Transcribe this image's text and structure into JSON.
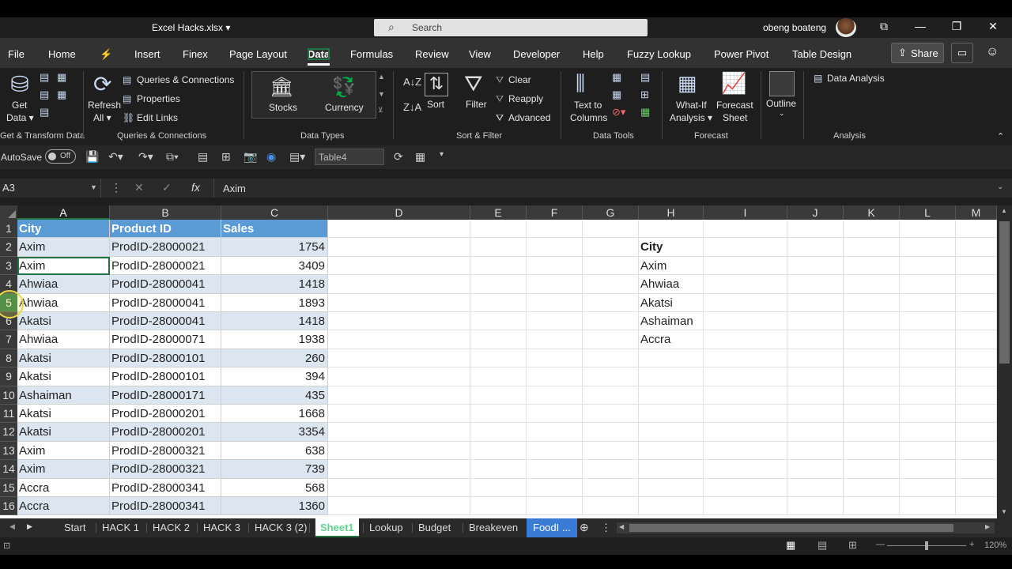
{
  "title": {
    "file_name": "Excel Hacks.xlsx ▾",
    "search_placeholder": "Search",
    "user_name": "obeng boateng",
    "btn_ribbon": "⧉",
    "btn_min": "—",
    "btn_restore": "❐",
    "btn_close": "✕"
  },
  "menu": {
    "items": [
      "File",
      "Home",
      "⚡",
      "Insert",
      "Finex",
      "Page Layout",
      "Data",
      "Formulas",
      "Review",
      "View",
      "Developer",
      "Help",
      "Fuzzy Lookup",
      "Power Pivot",
      "Table Design"
    ],
    "active": "Data",
    "share": "Share"
  },
  "ribbon": {
    "get_data": "Get",
    "get_data2": "Data ▾",
    "refresh": "Refresh",
    "refresh2": "All ▾",
    "queries_connections": "Queries & Connections",
    "properties": "Properties",
    "edit_links": "Edit Links",
    "stocks": "Stocks",
    "currency": "Currency",
    "sort": "Sort",
    "filter": "Filter",
    "clear": "Clear",
    "reapply": "Reapply",
    "advanced": "Advanced",
    "text_to_columns": "Text to",
    "text_to_columns2": "Columns",
    "whatif": "What-If",
    "whatif2": "Analysis ▾",
    "forecast_sheet": "Forecast",
    "forecast_sheet2": "Sheet",
    "outline": "Outline",
    "data_analysis": "Data Analysis",
    "groups": {
      "get_transform": "Get & Transform Data",
      "queries": "Queries & Connections",
      "data_types": "Data Types",
      "sort_filter": "Sort & Filter",
      "data_tools": "Data Tools",
      "forecast": "Forecast",
      "analysis": "Analysis"
    }
  },
  "qat": {
    "autosave": "AutoSave",
    "toggle": "Off",
    "table_name": "Table4"
  },
  "formula_bar": {
    "name_box": "A3",
    "value": "Axim"
  },
  "columns": [
    "A",
    "B",
    "C",
    "D",
    "E",
    "F",
    "G",
    "H",
    "I",
    "J",
    "K",
    "L",
    "M"
  ],
  "rows": [
    "1",
    "2",
    "3",
    "4",
    "5",
    "6",
    "7",
    "8",
    "9",
    "10",
    "11",
    "12",
    "13",
    "14",
    "15",
    "16"
  ],
  "table": {
    "headers": [
      "City",
      "Product ID",
      "Sales"
    ],
    "rows": [
      [
        "Axim",
        "ProdID-28000021",
        "1754"
      ],
      [
        "Axim",
        "ProdID-28000021",
        "3409"
      ],
      [
        "Ahwiaa",
        "ProdID-28000041",
        "1418"
      ],
      [
        "Ahwiaa",
        "ProdID-28000041",
        "1893"
      ],
      [
        "Akatsi",
        "ProdID-28000041",
        "1418"
      ],
      [
        "Ahwiaa",
        "ProdID-28000071",
        "1938"
      ],
      [
        "Akatsi",
        "ProdID-28000101",
        "260"
      ],
      [
        "Akatsi",
        "ProdID-28000101",
        "394"
      ],
      [
        "Ashaiman",
        "ProdID-28000171",
        "435"
      ],
      [
        "Akatsi",
        "ProdID-28000201",
        "1668"
      ],
      [
        "Akatsi",
        "ProdID-28000201",
        "3354"
      ],
      [
        "Axim",
        "ProdID-28000321",
        "638"
      ],
      [
        "Axim",
        "ProdID-28000321",
        "739"
      ],
      [
        "Accra",
        "ProdID-28000341",
        "568"
      ],
      [
        "Accra",
        "ProdID-28000341",
        "1360"
      ]
    ]
  },
  "city_list": {
    "header": "City",
    "items": [
      "Axim",
      "Ahwiaa",
      "Akatsi",
      "Ashaiman",
      "Accra"
    ]
  },
  "sheets": [
    "Start",
    "HACK 1",
    "HACK 2",
    "HACK 3",
    "HACK 3 (2)",
    "Sheet1",
    "Lookup",
    "Budget",
    "Breakeven",
    "FoodI ..."
  ],
  "active_sheet": "Sheet1",
  "status": {
    "zoom": "120%"
  }
}
